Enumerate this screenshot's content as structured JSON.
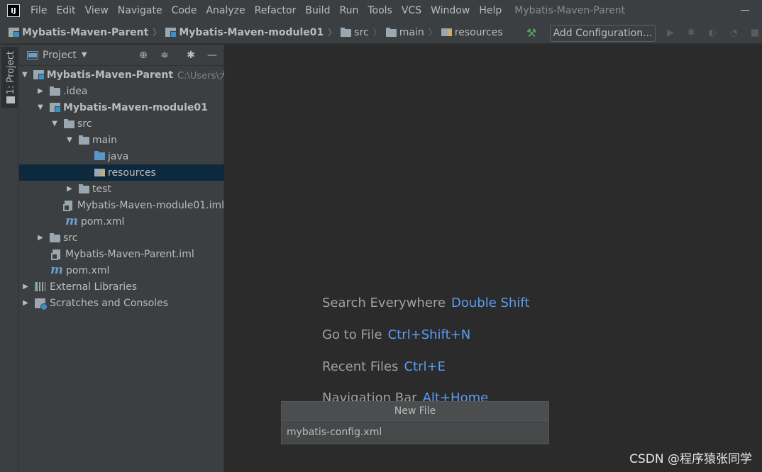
{
  "menubar": {
    "logo": "IJ",
    "items": [
      "File",
      "Edit",
      "View",
      "Navigate",
      "Code",
      "Analyze",
      "Refactor",
      "Build",
      "Run",
      "Tools",
      "VCS",
      "Window",
      "Help"
    ],
    "window_title": "Mybatis-Maven-Parent"
  },
  "navbar": {
    "crumbs": [
      "Mybatis-Maven-Parent",
      "Mybatis-Maven-module01",
      "src",
      "main",
      "resources"
    ],
    "add_configuration": "Add Configuration..."
  },
  "side_stripe": {
    "project_tab": "1: Project"
  },
  "project_panel": {
    "title": "Project",
    "tree": [
      {
        "label": "Mybatis-Maven-Parent",
        "path": "C:\\Users\\大"
      },
      {
        "label": ".idea"
      },
      {
        "label": "Mybatis-Maven-module01"
      },
      {
        "label": "src"
      },
      {
        "label": "main"
      },
      {
        "label": "java"
      },
      {
        "label": "resources"
      },
      {
        "label": "test"
      },
      {
        "label": "Mybatis-Maven-module01.iml"
      },
      {
        "label": "pom.xml"
      },
      {
        "label": "src"
      },
      {
        "label": "Mybatis-Maven-Parent.iml"
      },
      {
        "label": "pom.xml"
      },
      {
        "label": "External Libraries"
      },
      {
        "label": "Scratches and Consoles"
      }
    ]
  },
  "welcome": {
    "hints": [
      {
        "text": "Search Everywhere",
        "key": "Double Shift"
      },
      {
        "text": "Go to File",
        "key": "Ctrl+Shift+N"
      },
      {
        "text": "Recent Files",
        "key": "Ctrl+E"
      },
      {
        "text": "Navigation Bar",
        "key": "Alt+Home"
      }
    ]
  },
  "new_file_popup": {
    "title": "New File",
    "value": "mybatis-config.xml"
  },
  "watermark": "CSDN @程序猿张同学"
}
